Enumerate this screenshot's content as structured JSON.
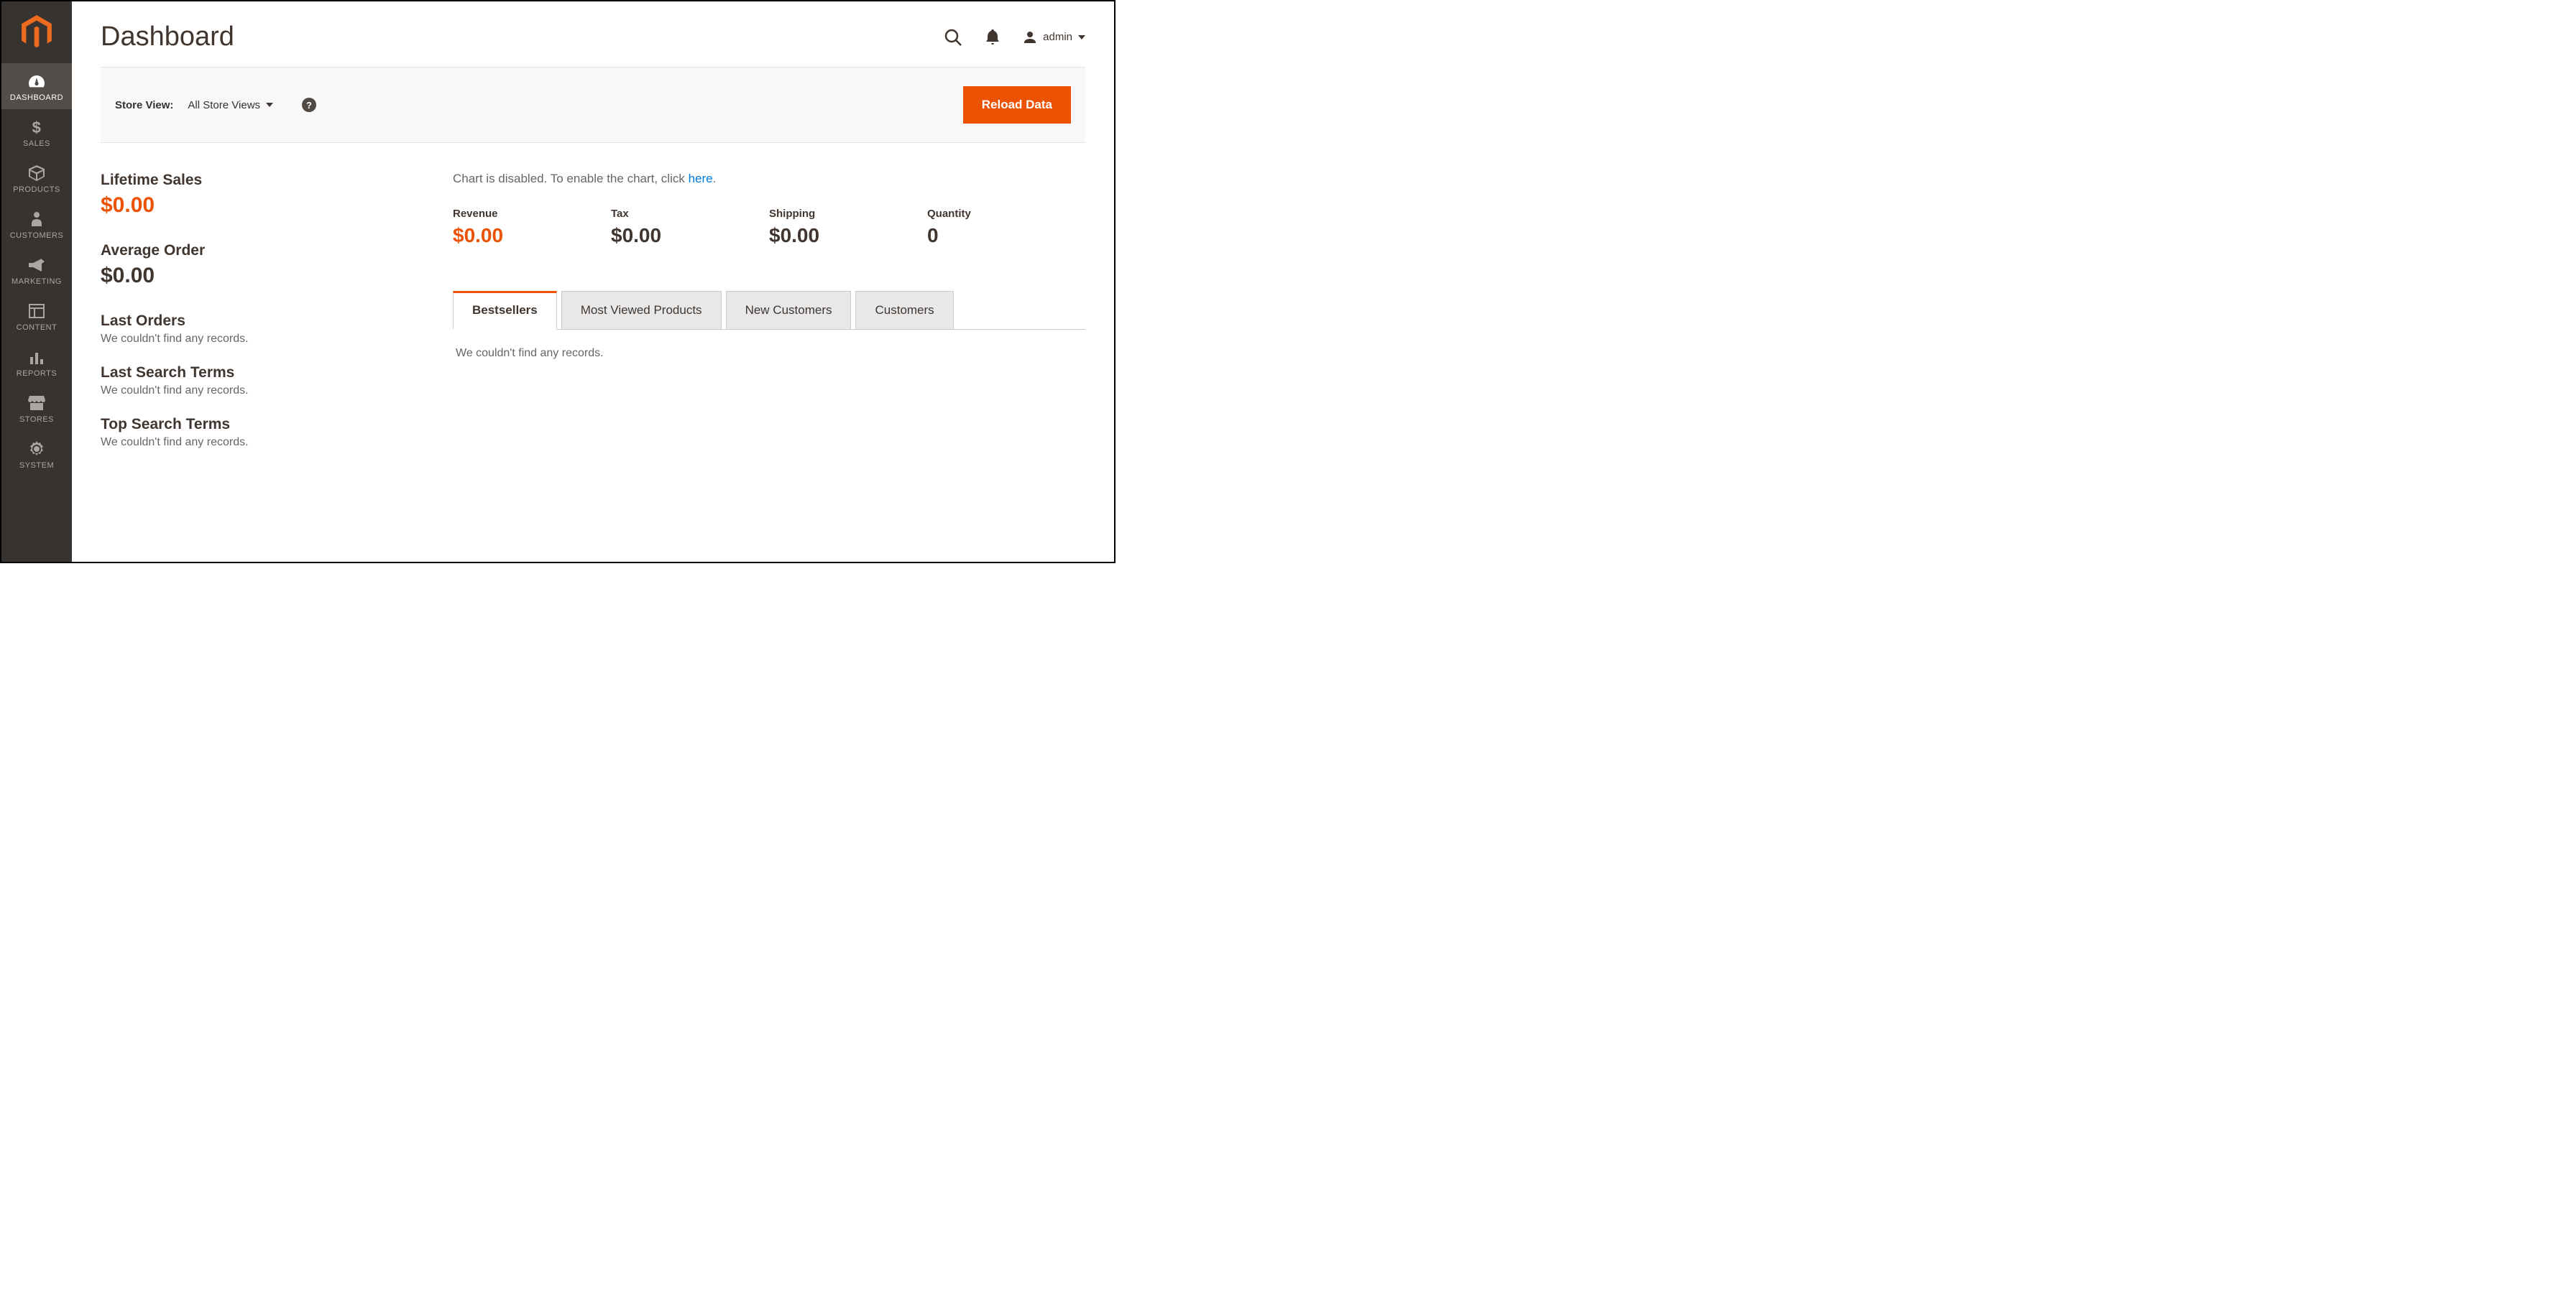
{
  "sidebar": {
    "items": [
      {
        "label": "DASHBOARD"
      },
      {
        "label": "SALES"
      },
      {
        "label": "PRODUCTS"
      },
      {
        "label": "CUSTOMERS"
      },
      {
        "label": "MARKETING"
      },
      {
        "label": "CONTENT"
      },
      {
        "label": "REPORTS"
      },
      {
        "label": "STORES"
      },
      {
        "label": "SYSTEM"
      }
    ]
  },
  "header": {
    "title": "Dashboard",
    "user": "admin"
  },
  "storeview": {
    "label": "Store View:",
    "selected": "All Store Views",
    "help": "?",
    "reload_label": "Reload Data"
  },
  "stats": {
    "lifetime_sales": {
      "title": "Lifetime Sales",
      "value": "$0.00"
    },
    "average_order": {
      "title": "Average Order",
      "value": "$0.00"
    },
    "last_orders": {
      "title": "Last Orders",
      "empty": "We couldn't find any records."
    },
    "last_search_terms": {
      "title": "Last Search Terms",
      "empty": "We couldn't find any records."
    },
    "top_search_terms": {
      "title": "Top Search Terms",
      "empty": "We couldn't find any records."
    }
  },
  "chart_notice": {
    "prefix": "Chart is disabled. To enable the chart, click ",
    "link": "here",
    "suffix": "."
  },
  "totals": {
    "revenue": {
      "label": "Revenue",
      "value": "$0.00"
    },
    "tax": {
      "label": "Tax",
      "value": "$0.00"
    },
    "shipping": {
      "label": "Shipping",
      "value": "$0.00"
    },
    "quantity": {
      "label": "Quantity",
      "value": "0"
    }
  },
  "tabs": [
    {
      "label": "Bestsellers"
    },
    {
      "label": "Most Viewed Products"
    },
    {
      "label": "New Customers"
    },
    {
      "label": "Customers"
    }
  ],
  "tab_content": {
    "empty": "We couldn't find any records."
  }
}
